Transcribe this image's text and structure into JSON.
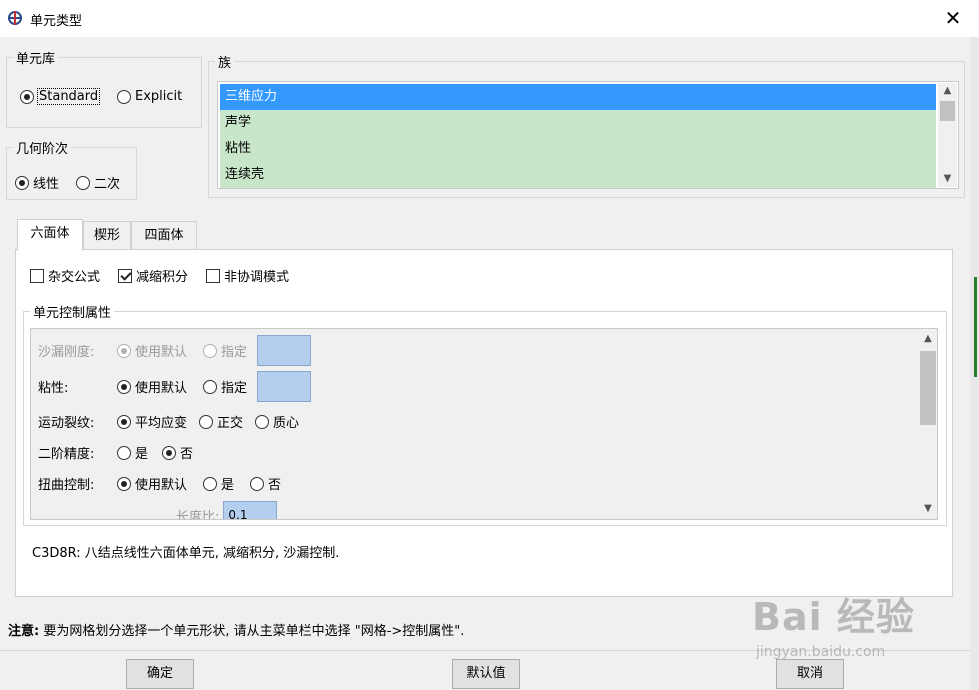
{
  "window": {
    "title": "单元类型",
    "close_glyph": "✕"
  },
  "library": {
    "legend": "单元库",
    "options": [
      {
        "label": "Standard",
        "selected": true
      },
      {
        "label": "Explicit",
        "selected": false
      }
    ]
  },
  "geometric_order": {
    "legend": "几何阶次",
    "options": [
      {
        "label": "线性",
        "selected": true
      },
      {
        "label": "二次",
        "selected": false
      }
    ]
  },
  "family": {
    "legend": "族",
    "items": [
      {
        "label": "三维应力",
        "selected": true
      },
      {
        "label": "声学",
        "selected": false
      },
      {
        "label": "粘性",
        "selected": false
      },
      {
        "label": "连续壳",
        "selected": false
      }
    ]
  },
  "tabs": [
    {
      "label": "六面体",
      "active": true
    },
    {
      "label": "楔形",
      "active": false
    },
    {
      "label": "四面体",
      "active": false
    }
  ],
  "element_options": [
    {
      "label": "杂交公式",
      "checked": false
    },
    {
      "label": "减缩积分",
      "checked": true
    },
    {
      "label": "非协调模式",
      "checked": false
    }
  ],
  "controls": {
    "legend": "单元控制属性",
    "hourglass": {
      "label": "沙漏刚度:",
      "use_default": "使用默认",
      "specify": "指定",
      "disabled": true
    },
    "viscosity": {
      "label": "粘性:",
      "use_default": "使用默认",
      "specify": "指定"
    },
    "distortion_kinematic": {
      "label": "运动裂纹:",
      "opt1": "平均应变",
      "opt2": "正交",
      "opt3": "质心"
    },
    "second_order_accuracy": {
      "label": "二阶精度:",
      "yes": "是",
      "no": "否"
    },
    "distortion_control": {
      "label": "扭曲控制:",
      "use_default": "使用默认",
      "yes": "是",
      "no": "否"
    },
    "length_ratio": {
      "label": "长度比:",
      "value": "0.1"
    }
  },
  "description": "C3D8R:  八结点线性六面体单元, 减缩积分, 沙漏控制.",
  "note": {
    "prefix": "注意:",
    "text": "要为网格划分选择一个单元形状, 请从主菜单栏中选择 \"网格->控制属性\"."
  },
  "buttons": {
    "ok": "确定",
    "defaults": "默认值",
    "cancel": "取消"
  },
  "watermark": {
    "text": "Bai 经验",
    "url": "jingyan.baidu.com"
  },
  "colors": {
    "list_item_bg": "#c8e6c9",
    "list_selected_bg": "#3399ff",
    "entry_bg": "#b4cef0"
  }
}
